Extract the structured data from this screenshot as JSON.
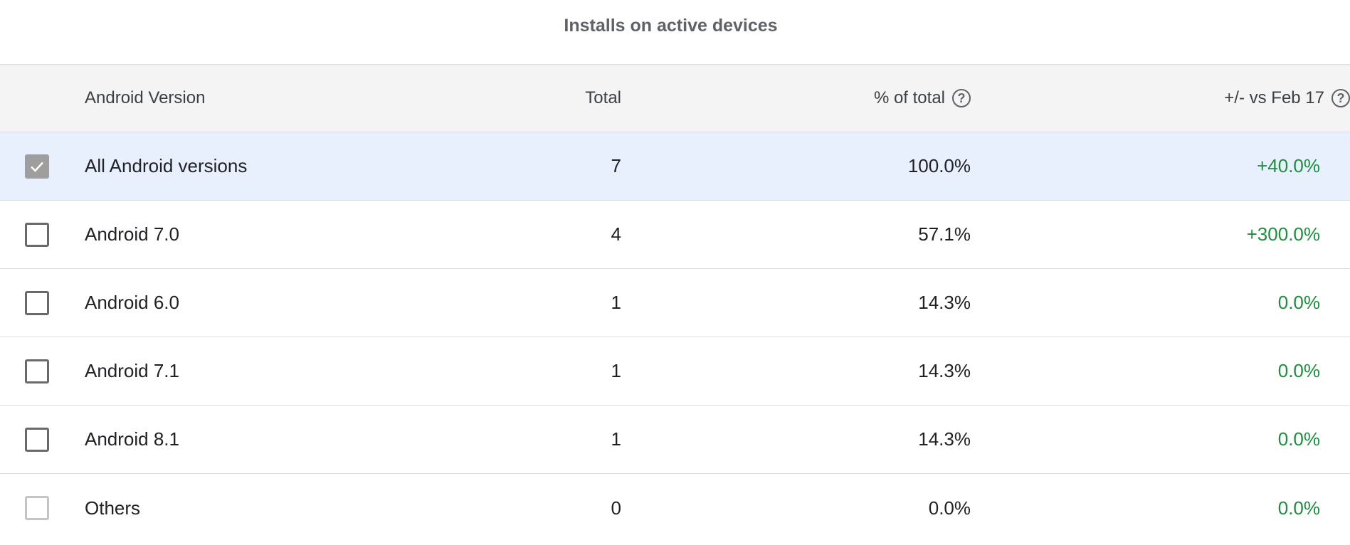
{
  "title": "Installs on active devices",
  "columns": {
    "version": "Android Version",
    "total": "Total",
    "percent": "% of total",
    "change": "+/- vs Feb 17"
  },
  "colors": {
    "positive": "#1e8e3e",
    "selected_row": "#e8f0fe",
    "header_bg": "#f4f4f4"
  },
  "rows": [
    {
      "name": "All Android versions",
      "total": "7",
      "percent": "100.0%",
      "change": "+40.0%",
      "checked": true
    },
    {
      "name": "Android 7.0",
      "total": "4",
      "percent": "57.1%",
      "change": "+300.0%",
      "checked": false
    },
    {
      "name": "Android 6.0",
      "total": "1",
      "percent": "14.3%",
      "change": "0.0%",
      "checked": false
    },
    {
      "name": "Android 7.1",
      "total": "1",
      "percent": "14.3%",
      "change": "0.0%",
      "checked": false
    },
    {
      "name": "Android 8.1",
      "total": "1",
      "percent": "14.3%",
      "change": "0.0%",
      "checked": false
    },
    {
      "name": "Others",
      "total": "0",
      "percent": "0.0%",
      "change": "0.0%",
      "checked": false,
      "disabled": true
    }
  ]
}
